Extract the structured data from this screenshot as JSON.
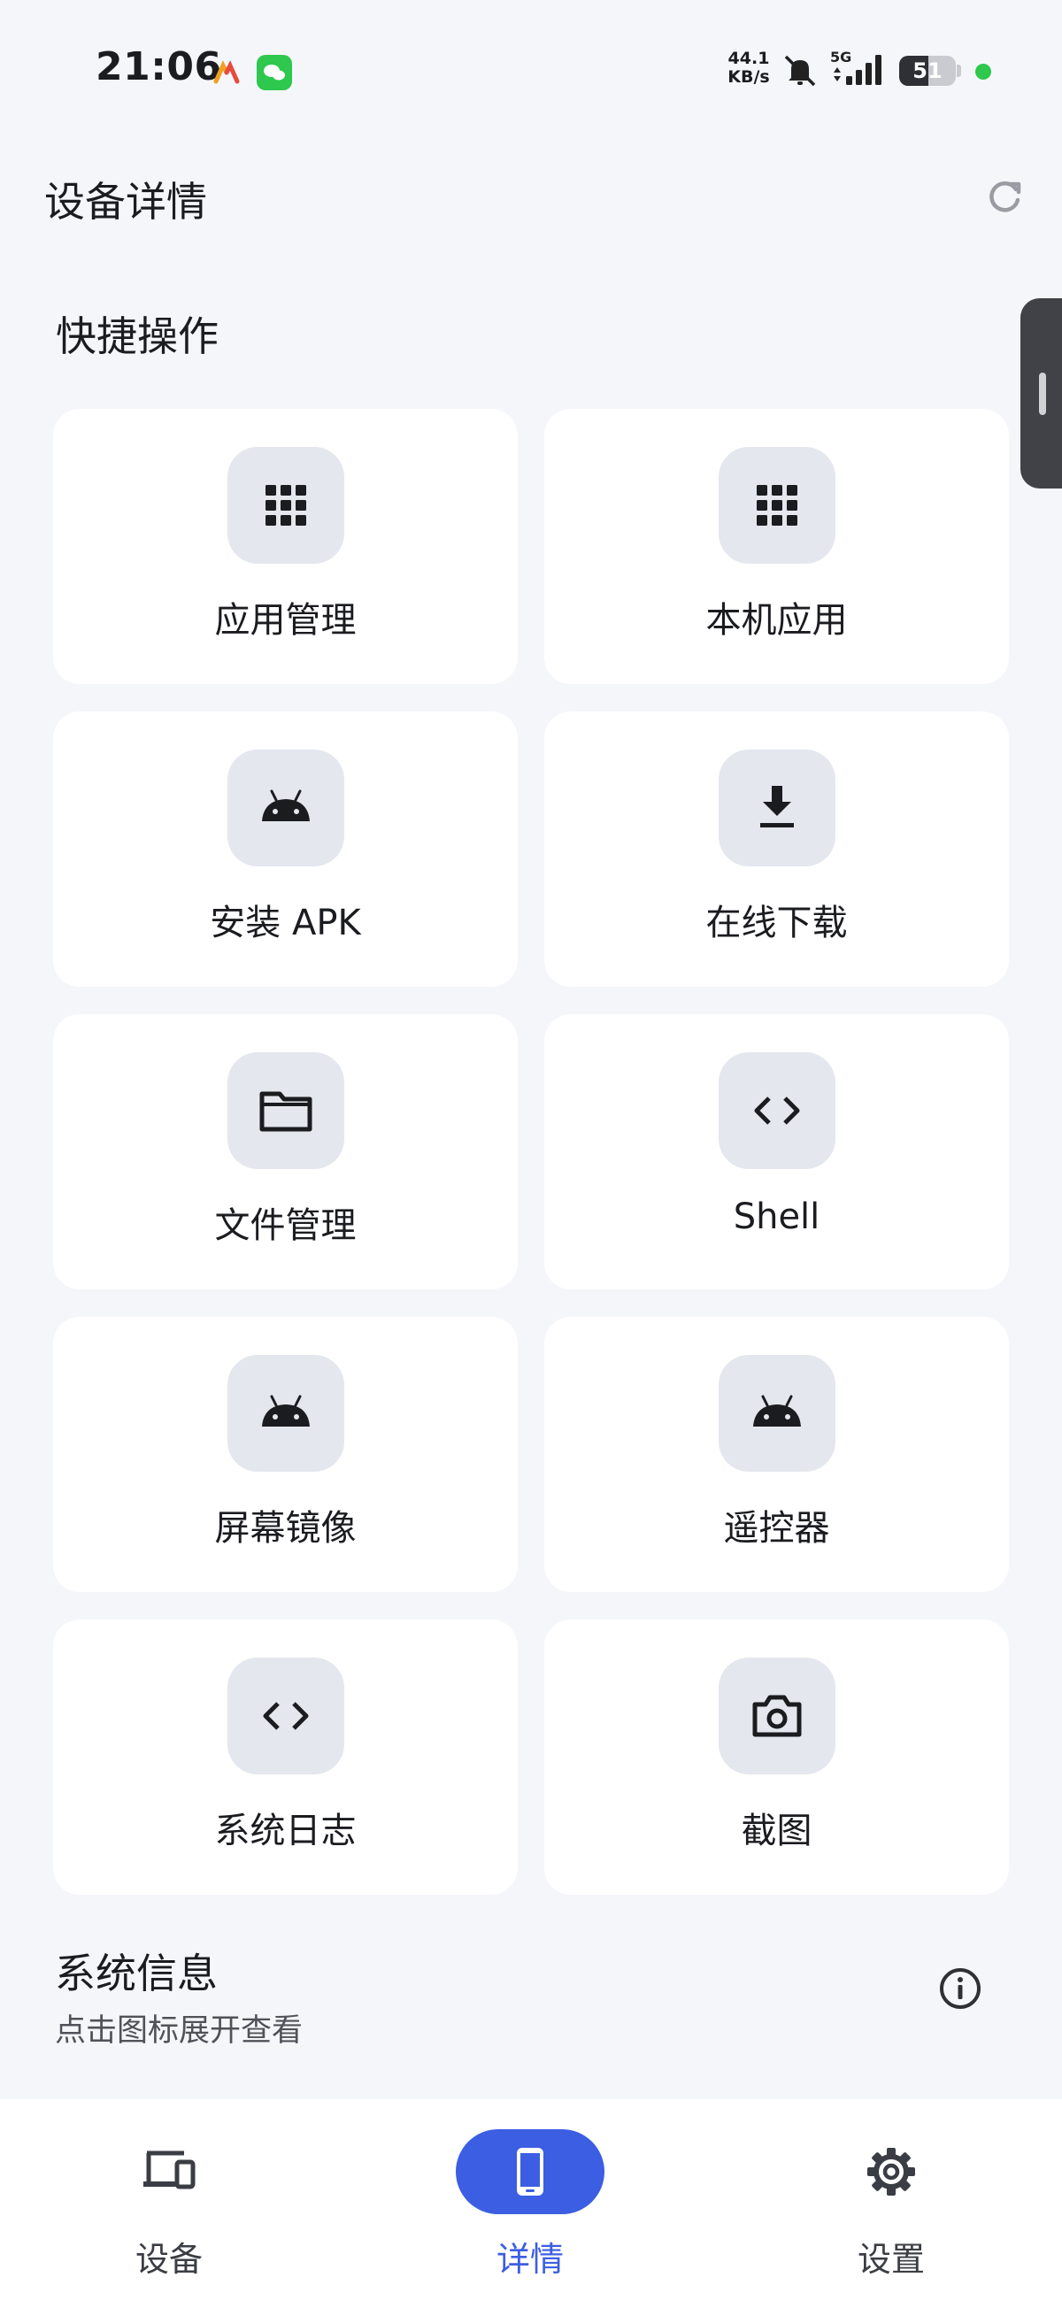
{
  "status_bar": {
    "time": "21:06",
    "net_speed_value": "44.1",
    "net_speed_unit": "KB/s",
    "network_type": "5G",
    "battery_level": "51",
    "icons": [
      "app-notification-icon",
      "wechat-icon",
      "mute-icon",
      "signal-icon",
      "battery-icon",
      "privacy-dot"
    ]
  },
  "header": {
    "title": "设备详情",
    "refresh_icon": "refresh-icon"
  },
  "quick_actions": {
    "title": "快捷操作",
    "items": [
      {
        "label": "应用管理",
        "icon": "apps-grid-icon"
      },
      {
        "label": "本机应用",
        "icon": "apps-grid-icon"
      },
      {
        "label": "安装 APK",
        "icon": "android-icon"
      },
      {
        "label": "在线下载",
        "icon": "download-icon"
      },
      {
        "label": "文件管理",
        "icon": "folder-icon"
      },
      {
        "label": "Shell",
        "icon": "code-icon"
      },
      {
        "label": "屏幕镜像",
        "icon": "android-icon"
      },
      {
        "label": "遥控器",
        "icon": "android-icon"
      },
      {
        "label": "系统日志",
        "icon": "code-icon"
      },
      {
        "label": "截图",
        "icon": "camera-icon"
      }
    ]
  },
  "system_info": {
    "title": "系统信息",
    "subtitle": "点击图标展开查看",
    "icon": "info-icon"
  },
  "bottom_nav": {
    "items": [
      {
        "label": "设备",
        "icon": "devices-icon",
        "active": false
      },
      {
        "label": "详情",
        "icon": "phone-icon",
        "active": true
      },
      {
        "label": "设置",
        "icon": "gear-icon",
        "active": false
      }
    ]
  },
  "colors": {
    "accent": "#3C5EE3",
    "background": "#F5F6FA",
    "card": "#FFFFFF",
    "icon_box": "#E4E7EE"
  }
}
